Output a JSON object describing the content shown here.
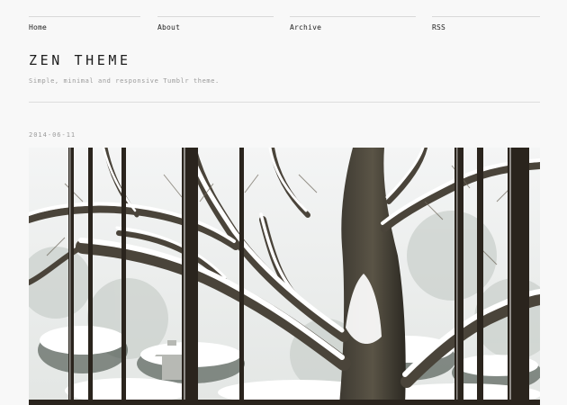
{
  "nav": {
    "items": [
      {
        "label": "Home"
      },
      {
        "label": "About"
      },
      {
        "label": "Archive"
      },
      {
        "label": "RSS"
      }
    ]
  },
  "site": {
    "title": "ZEN THEME",
    "tagline": "Simple, minimal and responsive Tumblr theme."
  },
  "post": {
    "date": "2014-06-11"
  },
  "colors": {
    "background": "#f8f8f8",
    "text": "#222222",
    "muted": "#9a9a9a",
    "divider": "#dddddd"
  }
}
